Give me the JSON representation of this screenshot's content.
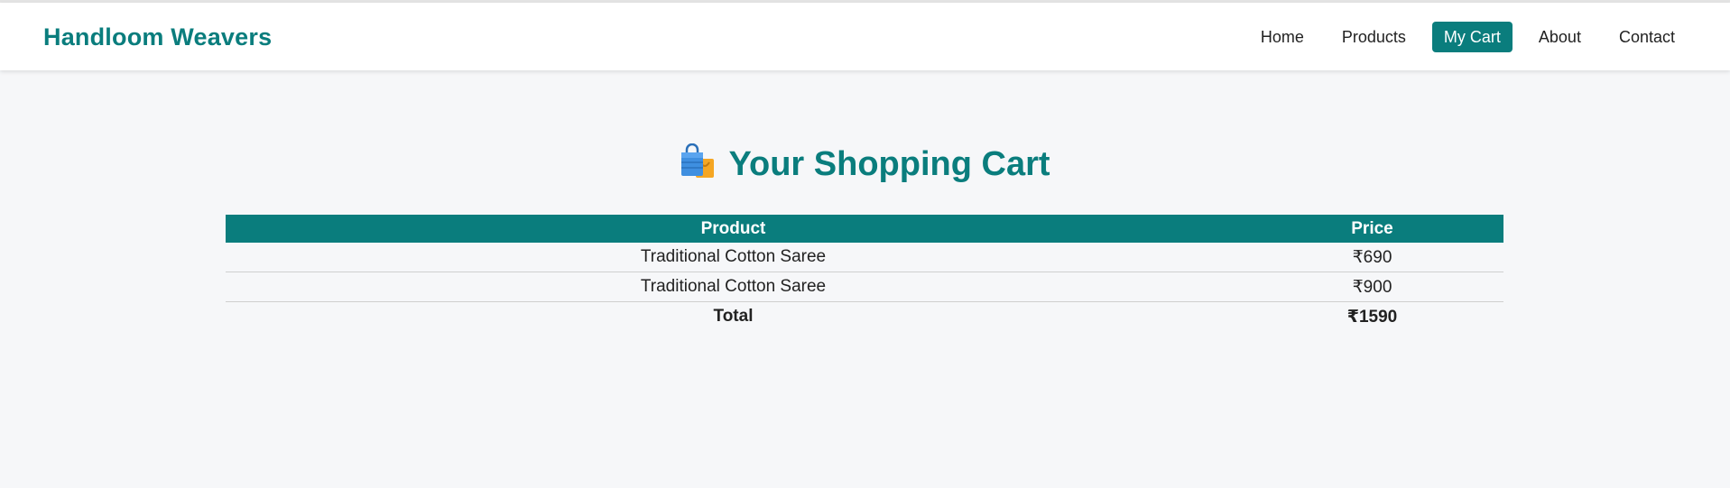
{
  "brand": {
    "name": "Handloom Weavers"
  },
  "nav": {
    "items": [
      {
        "label": "Home",
        "active": false
      },
      {
        "label": "Products",
        "active": false
      },
      {
        "label": "My Cart",
        "active": true
      },
      {
        "label": "About",
        "active": false
      },
      {
        "label": "Contact",
        "active": false
      }
    ]
  },
  "page": {
    "title": "Your Shopping Cart",
    "title_icon": "shopping-bags-icon"
  },
  "cart": {
    "headers": {
      "product": "Product",
      "price": "Price"
    },
    "rows": [
      {
        "product": "Traditional Cotton Saree",
        "price": "₹690"
      },
      {
        "product": "Traditional Cotton Saree",
        "price": "₹900"
      }
    ],
    "total": {
      "label": "Total",
      "value": "₹1590"
    }
  },
  "colors": {
    "accent": "#0a7d7d",
    "background": "#f6f7f9",
    "header_bg": "#ffffff",
    "text": "#222222"
  }
}
